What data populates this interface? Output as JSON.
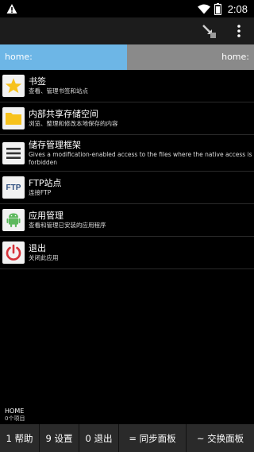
{
  "status_bar": {
    "time": "2:08",
    "icons": [
      "warning-icon",
      "wifi-icon",
      "battery-icon"
    ]
  },
  "action_bar": {
    "icons": [
      "shortcut-arrow-icon",
      "more-vertical-icon"
    ]
  },
  "tabs": {
    "left": "home:",
    "right": "home:",
    "colors": {
      "active": "#6db6e6",
      "inactive": "#8a8a8a"
    }
  },
  "items": [
    {
      "title": "书签",
      "subtitle": "查看、管理书签和站点",
      "icon": "star-icon"
    },
    {
      "title": "内部共享存储空间",
      "subtitle": "浏览、整理和修改本地保存的内容",
      "icon": "folder-icon"
    },
    {
      "title": "储存管理框架",
      "subtitle": "Gives a modification-enabled access to the files where the native access is forbidden",
      "icon": "menu-lines-icon"
    },
    {
      "title": "FTP站点",
      "subtitle": "连接FTP",
      "icon": "ftp-icon"
    },
    {
      "title": "应用管理",
      "subtitle": "查看和管理已安装的应用程序",
      "icon": "android-icon"
    },
    {
      "title": "退出",
      "subtitle": "关闭此应用",
      "icon": "power-icon"
    }
  ],
  "footer": {
    "title": "HOME",
    "subtitle": "0个项目"
  },
  "bottom_buttons": [
    {
      "label": "1 帮助"
    },
    {
      "label": "9 设置"
    },
    {
      "label": "0 退出"
    },
    {
      "label": "= 同步面板"
    },
    {
      "label": "~ 交换面板"
    }
  ]
}
